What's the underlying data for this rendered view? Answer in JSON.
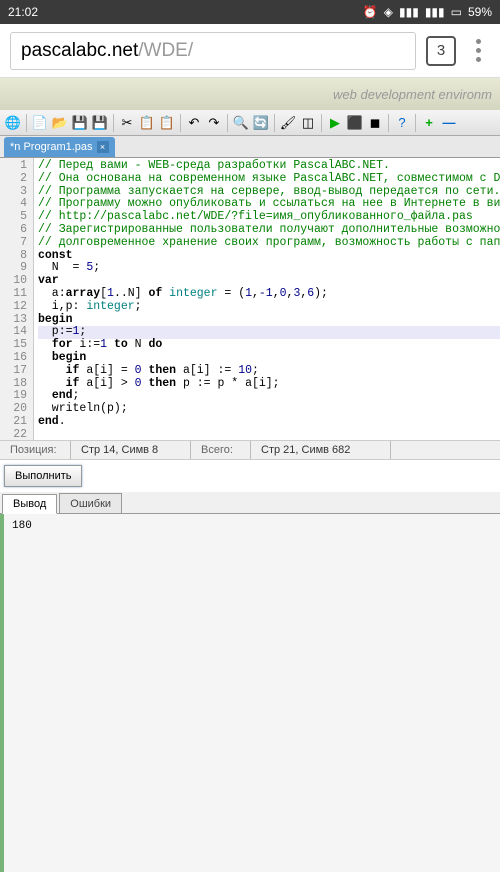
{
  "status": {
    "time": "21:02",
    "battery": "59%"
  },
  "browser": {
    "url_main": "pascalabc.net",
    "url_path": "/WDE/",
    "tab_count": "3"
  },
  "banner": {
    "text": "web development environm"
  },
  "file_tab": {
    "name": "*n Program1.pas"
  },
  "code": {
    "lines": [
      {
        "n": "1",
        "html": "<span class='comment'>// Перед вами - WEB-среда разработки PascalABC.NET.</span>"
      },
      {
        "n": "2",
        "html": "<span class='comment'>// Она основана на современном языке PascalABC.NET, совместимом с De</span>"
      },
      {
        "n": "3",
        "html": "<span class='comment'>// Программа запускается на сервере, ввод-вывод передается по сети.</span>"
      },
      {
        "n": "4",
        "html": "<span class='comment'>// Программу можно опубликовать и ссылаться на нее в Интернете в вид</span>"
      },
      {
        "n": "5",
        "html": "<span class='comment'>// http://pascalabc.net/WDE/?file=имя_опубликованного_файла.pas</span>"
      },
      {
        "n": "6",
        "html": "<span class='comment'>// Зарегистрированные пользователи получают дополнительные возможнос</span>"
      },
      {
        "n": "7",
        "html": "<span class='comment'>// долговременное хранение своих программ, возможность работы с папк</span>"
      },
      {
        "n": "8",
        "html": "<span class='keyword'>const</span>"
      },
      {
        "n": "9",
        "html": "  N  = <span class='number'>5</span>;"
      },
      {
        "n": "10",
        "html": "<span class='keyword'>var</span>"
      },
      {
        "n": "11",
        "html": "  a:<span class='keyword'>array</span>[<span class='number'>1</span>..N] <span class='keyword'>of</span> <span class='type'>integer</span> = (<span class='number'>1</span>,<span class='number'>-1</span>,<span class='number'>0</span>,<span class='number'>3</span>,<span class='number'>6</span>);"
      },
      {
        "n": "12",
        "html": "  i,p: <span class='type'>integer</span>;"
      },
      {
        "n": "13",
        "html": "<span class='keyword'>begin</span>"
      },
      {
        "n": "14",
        "html": "  p:=<span class='number'>1</span>;",
        "hl": true
      },
      {
        "n": "15",
        "html": "  <span class='keyword'>for</span> i:=<span class='number'>1</span> <span class='keyword'>to</span> N <span class='keyword'>do</span>"
      },
      {
        "n": "16",
        "html": "  <span class='keyword'>begin</span>"
      },
      {
        "n": "17",
        "html": "    <span class='keyword'>if</span> a[i] = <span class='number'>0</span> <span class='keyword'>then</span> a[i] := <span class='number'>10</span>;"
      },
      {
        "n": "18",
        "html": "    <span class='keyword'>if</span> a[i] > <span class='number'>0</span> <span class='keyword'>then</span> p := p * a[i];"
      },
      {
        "n": "19",
        "html": "  <span class='keyword'>end</span>;"
      },
      {
        "n": "20",
        "html": "  writeln(p);"
      },
      {
        "n": "21",
        "html": "<span class='keyword'>end</span>."
      },
      {
        "n": "22",
        "html": ""
      }
    ]
  },
  "editor_status": {
    "pos_label": "Позиция:",
    "pos_value": "Стр 14, Симв 8",
    "total_label": "Всего:",
    "total_value": "Стр 21, Симв 682"
  },
  "run": {
    "label": "Выполнить"
  },
  "output_tabs": {
    "active": "Вывод",
    "inactive": "Ошибки"
  },
  "output": {
    "text": "180"
  }
}
